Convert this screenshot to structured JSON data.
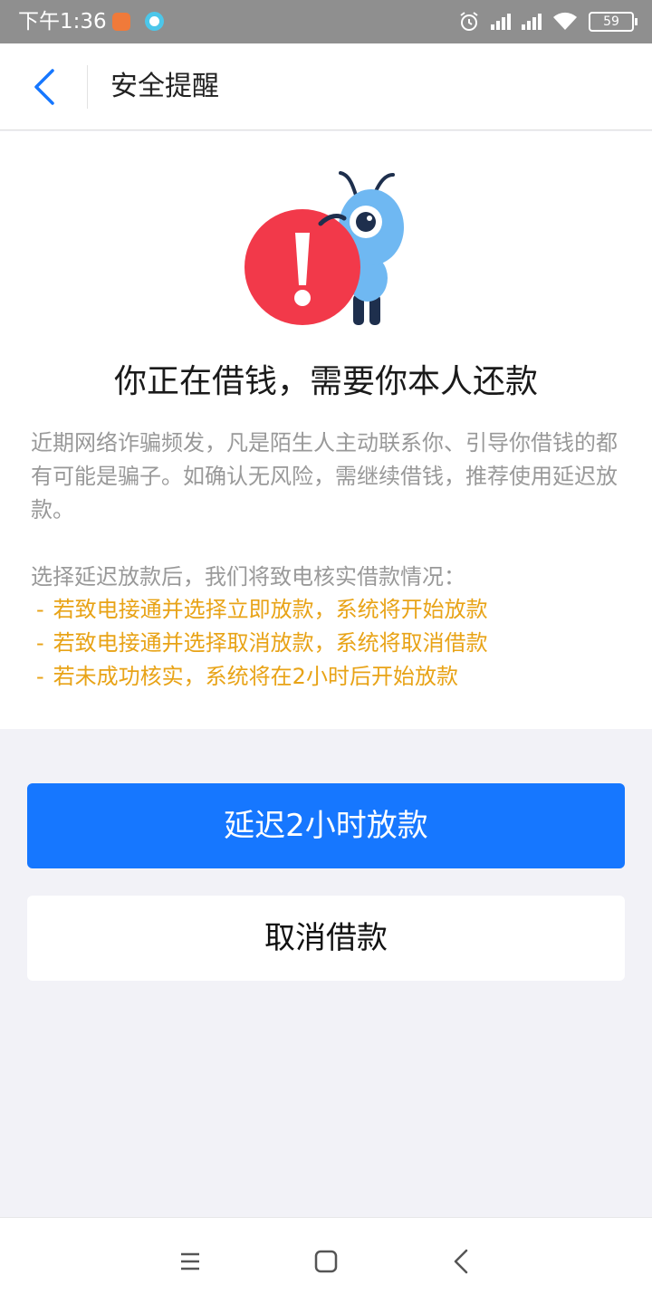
{
  "status_bar": {
    "time": "下午1:36",
    "battery": "59",
    "icons": [
      "app-notification-icon",
      "browser-icon",
      "alarm-icon",
      "signal-icon",
      "signal-icon",
      "wifi-icon",
      "battery-icon"
    ]
  },
  "nav": {
    "back_icon": "chevron-left-icon",
    "title": "安全提醒"
  },
  "alert": {
    "illustration": "ant-mascot-warning-icon",
    "headline": "你正在借钱，需要你本人还款",
    "description": "近期网络诈骗频发，凡是陌生人主动联系你、引导你借钱的都有可能是骗子。如确认无风险，需继续借钱，推荐使用延迟放款。",
    "sub_title": "选择延迟放款后，我们将致电核实借款情况：",
    "bullets": [
      {
        "dash": "-",
        "text": "若致电接通并选择立即放款，系统将开始放款"
      },
      {
        "dash": "-",
        "text": "若致电接通并选择取消放款，系统将取消借款"
      },
      {
        "dash": "-",
        "text": "若未成功核实，系统将在2小时后开始放款"
      }
    ]
  },
  "actions": {
    "primary": "延迟2小时放款",
    "secondary": "取消借款"
  },
  "bottom_nav": {
    "icons": [
      "menu-icon",
      "home-icon",
      "back-icon"
    ]
  },
  "colors": {
    "accent": "#1677ff",
    "warning_text": "#e8a317",
    "alert_red": "#f2394a",
    "mascot_blue": "#6fb8f2"
  }
}
